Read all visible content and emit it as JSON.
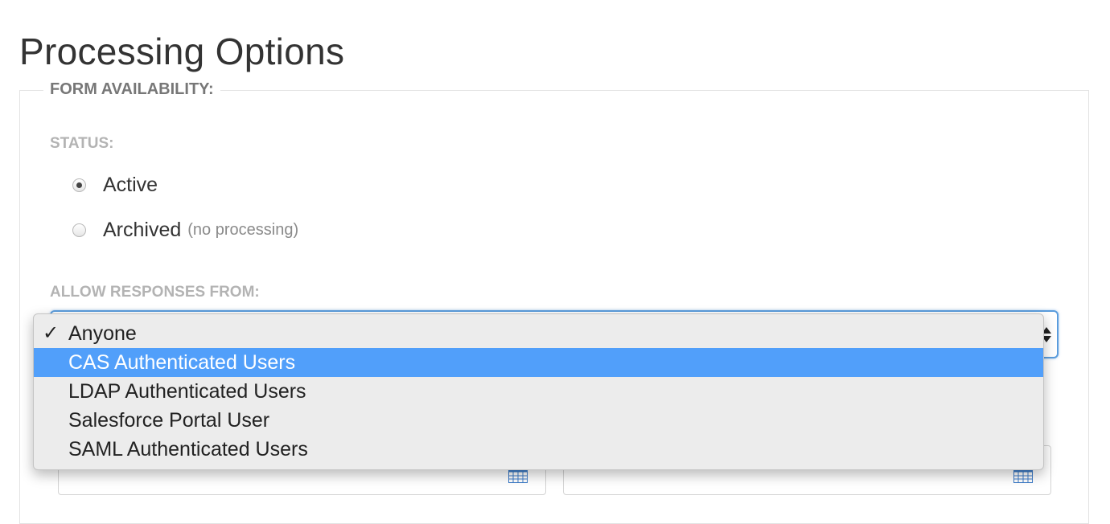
{
  "page": {
    "title": "Processing Options"
  },
  "form_availability": {
    "legend": "FORM AVAILABILITY:",
    "status": {
      "label": "STATUS:",
      "options": [
        {
          "label": "Active",
          "note": "",
          "checked": true
        },
        {
          "label": "Archived",
          "note": "(no processing)",
          "checked": false
        }
      ]
    },
    "allow_responses": {
      "label": "ALLOW RESPONSES FROM:",
      "selected": "Anyone",
      "highlighted": "CAS Authenticated Users",
      "options": [
        "Anyone",
        "CAS Authenticated Users",
        "LDAP Authenticated Users",
        "Salesforce Portal User",
        "SAML Authenticated Users"
      ]
    }
  },
  "icons": {
    "check": "check-mark-icon",
    "calendar": "calendar-icon",
    "select_arrows": "up-down-arrows-icon"
  },
  "colors": {
    "highlight": "#519ffa",
    "focus_border": "#5b9ddd",
    "legend_text": "#777777",
    "muted_label": "#b3b3b3",
    "calendar_icon": "#3d7cc9"
  }
}
